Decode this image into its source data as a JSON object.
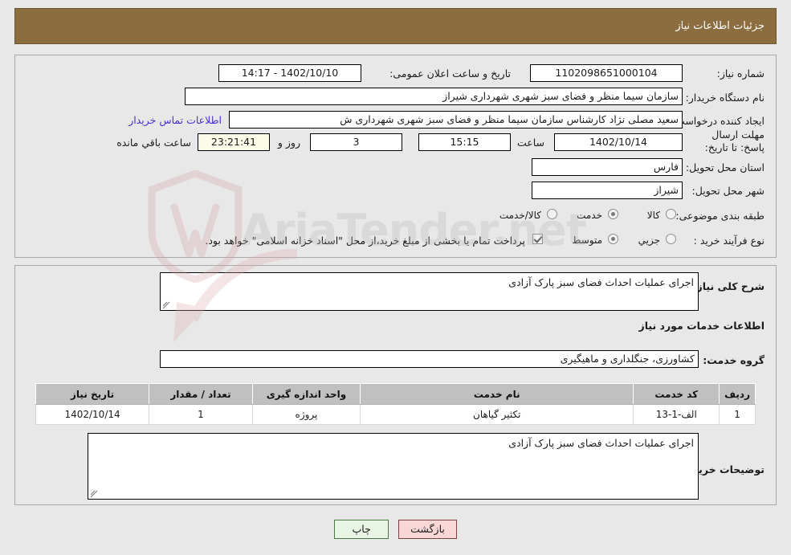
{
  "header": {
    "title": "جزئیات اطلاعات نیاز",
    "bar_color": "#8b6d40"
  },
  "watermark": {
    "text": "AriaTender.net"
  },
  "top_panel": {
    "need_number_label": "شماره نیاز:",
    "need_number_value": "1102098651000104",
    "announce_label": "تاریخ و ساعت اعلان عمومی:",
    "announce_value": "1402/10/10 - 14:17",
    "buyer_org_label": "نام دستگاه خریدار:",
    "buyer_org_value": "سازمان سیما منظر و فضای سبز شهری شهرداری شیراز",
    "requester_label": "ایجاد کننده درخواست:",
    "requester_value": "سعید مصلی نژاد کارشناس سازمان سیما منظر و فضای سبز شهری شهرداری ش",
    "contact_link": "اطلاعات تماس خریدار",
    "deadline_label": "مهلت ارسال پاسخ: تا تاریخ:",
    "deadline_date": "1402/10/14",
    "time_label": "ساعت",
    "deadline_time": "15:15",
    "days_value": "3",
    "days_label": "روز و",
    "countdown_value": "23:21:41",
    "remaining_label": "ساعت باقي مانده",
    "province_label": "استان محل تحویل:",
    "province_value": "فارس",
    "city_label": "شهر محل تحویل:",
    "city_value": "شیراز",
    "category_label": "طبقه بندی موضوعی:",
    "category_options": [
      {
        "label": "کالا",
        "selected": false
      },
      {
        "label": "خدمت",
        "selected": true
      },
      {
        "label": "کالا/خدمت",
        "selected": false
      }
    ],
    "process_label": "نوع فرآیند خرید :",
    "process_options": [
      {
        "label": "جزیي",
        "selected": false
      },
      {
        "label": "متوسط",
        "selected": true
      }
    ],
    "treasury_checkbox_checked": true,
    "treasury_note": "پرداخت تمام یا بخشی از مبلغ خرید،از محل \"اسناد خزانه اسلامی\" خواهد بود."
  },
  "mid_panel": {
    "summary_label": "شرح کلی نیاز:",
    "summary_value": "اجرای عملیات احداث فضای سبز پارک آزادی",
    "services_section_title": "اطلاعات خدمات مورد نیاز",
    "service_group_label": "گروه خدمت:",
    "service_group_value": "کشاورزی، جنگلداری و ماهیگیری",
    "buyer_notes_label": "توضیحات خریدار:",
    "buyer_notes_value": "اجرای عملیات احداث فضای سبز پارک آزادی"
  },
  "table": {
    "columns": [
      "ردیف",
      "کد خدمت",
      "نام خدمت",
      "واحد اندازه گیری",
      "تعداد / مقدار",
      "تاریخ نیاز"
    ],
    "rows": [
      {
        "row_no": "1",
        "service_code": "الف-1-13",
        "service_name": "تکثیر گیاهان",
        "unit": "پروژه",
        "quantity": "1",
        "need_date": "1402/10/14"
      }
    ]
  },
  "buttons": {
    "print_label": "چاپ",
    "back_label": "بازگشت",
    "print_color": "#e8f5e4",
    "back_color": "#f9d7d7"
  }
}
